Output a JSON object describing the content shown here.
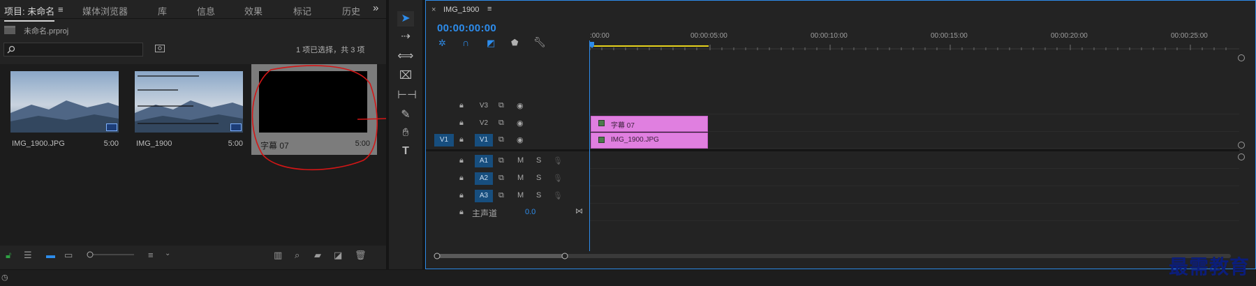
{
  "project_panel": {
    "tabs": [
      "项目: 未命名",
      "媒体浏览器",
      "库",
      "信息",
      "效果",
      "标记",
      "历史"
    ],
    "menu_icon": "≡",
    "more_icon": "»",
    "project_file": "未命名.prproj",
    "search_placeholder": "",
    "selection_status": "1 项已选择，共 3 项",
    "items": [
      {
        "name": "IMG_1900.JPG",
        "duration": "5:00"
      },
      {
        "name": "IMG_1900",
        "duration": "5:00"
      },
      {
        "name": "字幕 07",
        "duration": "5:00"
      }
    ]
  },
  "timeline": {
    "sequence_name": "IMG_1900",
    "close_icon": "×",
    "menu_icon": "≡",
    "timecode": "00:00:00:00",
    "ruler_labels": [
      ":00:00",
      "00:00:05:00",
      "00:00:10:00",
      "00:00:15:00",
      "00:00:20:00",
      "00:00:25:00"
    ],
    "video_tracks": [
      {
        "name": "V3",
        "source": ""
      },
      {
        "name": "V2",
        "source": ""
      },
      {
        "name": "V1",
        "source": "V1"
      }
    ],
    "audio_tracks": [
      {
        "name": "A1",
        "m": "M",
        "s": "S"
      },
      {
        "name": "A2",
        "m": "M",
        "s": "S"
      },
      {
        "name": "A3",
        "m": "M",
        "s": "S"
      }
    ],
    "master_label": "主声道",
    "master_value": "0.0",
    "clips": [
      {
        "track": "V2",
        "label": "字幕 07"
      },
      {
        "track": "V1",
        "label": "IMG_1900.JPG"
      }
    ],
    "accent": "#2d8ceb",
    "clip_color": "#e07fe0"
  },
  "tools": [
    "selection-tool",
    "track-select-tool",
    "ripple-edit-tool",
    "razor-tool",
    "slip-tool",
    "pen-tool",
    "hand-tool",
    "type-tool"
  ],
  "watermark": "最需教育"
}
